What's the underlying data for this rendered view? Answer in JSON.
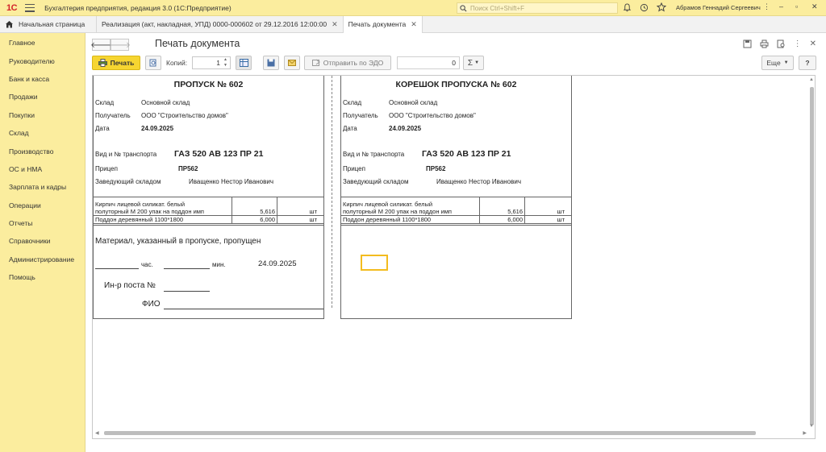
{
  "app": {
    "logo": "1С",
    "title": "Бухгалтерия предприятия, редакция 3.0  (1С:Предприятие)",
    "search_placeholder": "Поиск Ctrl+Shift+F",
    "user": "Абрамов Геннадий Сергеевич"
  },
  "tabs": {
    "home": "Начальная страница",
    "items": [
      {
        "label": "Реализация (акт, накладная, УПД) 0000-000602 от 29.12.2016 12:00:00"
      },
      {
        "label": "Печать документа"
      }
    ]
  },
  "sidebar": {
    "items": [
      {
        "label": "Главное"
      },
      {
        "label": "Руководителю"
      },
      {
        "label": "Банк и касса"
      },
      {
        "label": "Продажи"
      },
      {
        "label": "Покупки"
      },
      {
        "label": "Склад"
      },
      {
        "label": "Производство"
      },
      {
        "label": "ОС и НМА"
      },
      {
        "label": "Зарплата и кадры"
      },
      {
        "label": "Операции"
      },
      {
        "label": "Отчеты"
      },
      {
        "label": "Справочники"
      },
      {
        "label": "Администрирование"
      },
      {
        "label": "Помощь"
      }
    ]
  },
  "page": {
    "title": "Печать документа"
  },
  "toolbar": {
    "print_label": "Печать",
    "copies_label": "Копий:",
    "copies_value": "1",
    "edo_label": "Отправить по ЭДО",
    "sum_value": "0",
    "sigma": "Σ",
    "more_label": "Еще",
    "help_label": "?"
  },
  "doc": {
    "left": {
      "title": "ПРОПУСК № 602"
    },
    "right": {
      "title": "КОРЕШОК ПРОПУСКА № 602"
    },
    "labels": {
      "warehouse": "Склад",
      "recipient": "Получатель",
      "date": "Дата",
      "transport": "Вид и № транспорта",
      "trailer": "Прицеп",
      "keeper": "Заведующий складом"
    },
    "values": {
      "warehouse": "Основной склад",
      "recipient": "ООО \"Строительство домов\"",
      "date": "24.09.2025",
      "transport": "ГАЗ 520  АВ 123 ПР 21",
      "trailer": "ПР562",
      "keeper": "Иващенко Нестор Иванович"
    },
    "items": [
      {
        "name_line1": "Кирпич лицевой силикат. белый",
        "name_line2": "полуторный М 200 упак на поддон имп",
        "qty": "5,616",
        "unit": "шт"
      },
      {
        "name_line1": "Поддон  деревянный 1100*1800",
        "name_line2": "",
        "qty": "6,000",
        "unit": "шт"
      }
    ],
    "passed_text": "Материал, указанный в пропуске, пропущен",
    "hour_label": "час.",
    "min_label": "мин.",
    "passed_date": "24.09.2025",
    "guard_label": "Ин-р поста №",
    "fio_label": "ФИО"
  },
  "colors": {
    "sidebar_bg": "#fbed9e",
    "print_button": "#f6d531",
    "highlight_box": "#f3bc1f",
    "logo": "#d2242a"
  }
}
